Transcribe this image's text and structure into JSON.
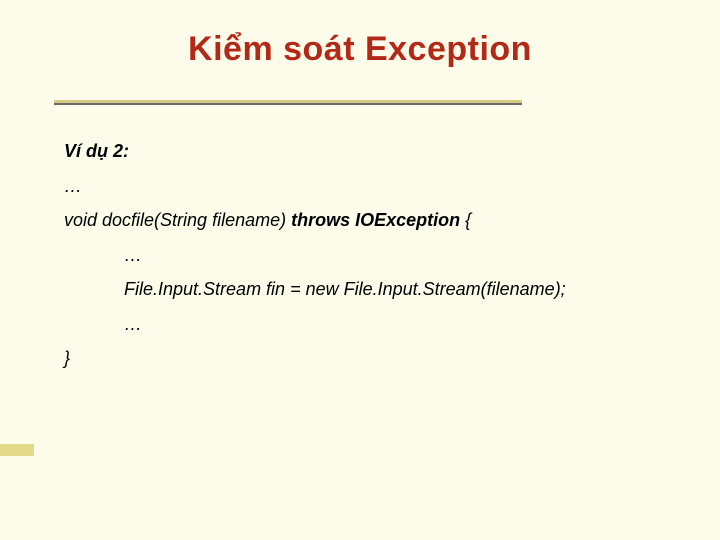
{
  "title": "Kiểm soát Exception",
  "lines": {
    "l1": "Ví dụ 2:",
    "l2": "…",
    "l3a": "void docfile(String  filename) ",
    "l3b": "throws IOException",
    "l3c": "  {",
    "l4": "…",
    "l5": "File.Input.Stream fin = new File.Input.Stream(filename);",
    "l6": "…",
    "l7": "}"
  }
}
